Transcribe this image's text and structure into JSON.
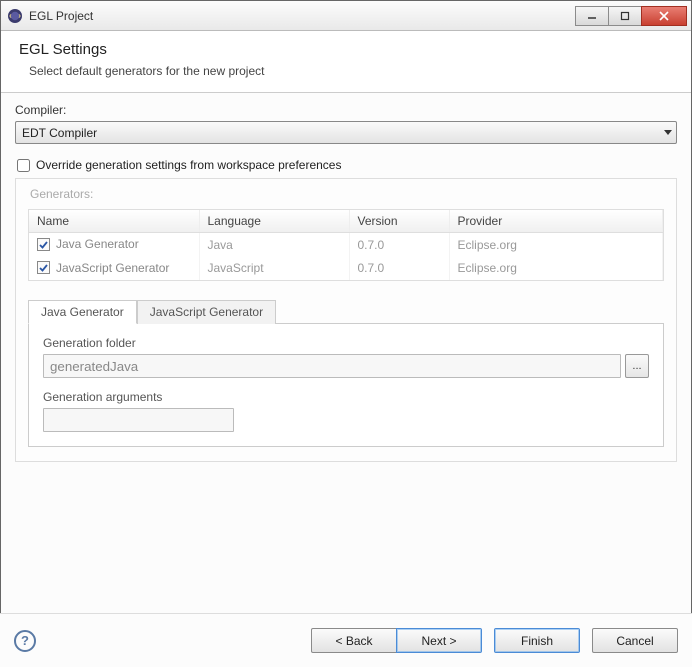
{
  "window": {
    "title": "EGL Project"
  },
  "header": {
    "title": "EGL Settings",
    "subtitle": "Select default generators for the new project"
  },
  "compiler": {
    "label": "Compiler:",
    "selected": "EDT Compiler"
  },
  "override": {
    "label": "Override generation settings from workspace preferences",
    "checked": false
  },
  "generators": {
    "caption": "Generators:",
    "columns": {
      "name": "Name",
      "language": "Language",
      "version": "Version",
      "provider": "Provider"
    },
    "rows": [
      {
        "checked": true,
        "name": "Java Generator",
        "language": "Java",
        "version": "0.7.0",
        "provider": "Eclipse.org"
      },
      {
        "checked": true,
        "name": "JavaScript Generator",
        "language": "JavaScript",
        "version": "0.7.0",
        "provider": "Eclipse.org"
      }
    ]
  },
  "tabs": {
    "items": [
      {
        "label": "Java Generator",
        "active": true
      },
      {
        "label": "JavaScript Generator",
        "active": false
      }
    ],
    "panel": {
      "gen_folder_label": "Generation folder",
      "gen_folder_value": "generatedJava",
      "browse_label": "...",
      "gen_args_label": "Generation arguments",
      "gen_args_value": ""
    }
  },
  "footer": {
    "back": "< Back",
    "next": "Next >",
    "finish": "Finish",
    "cancel": "Cancel"
  }
}
